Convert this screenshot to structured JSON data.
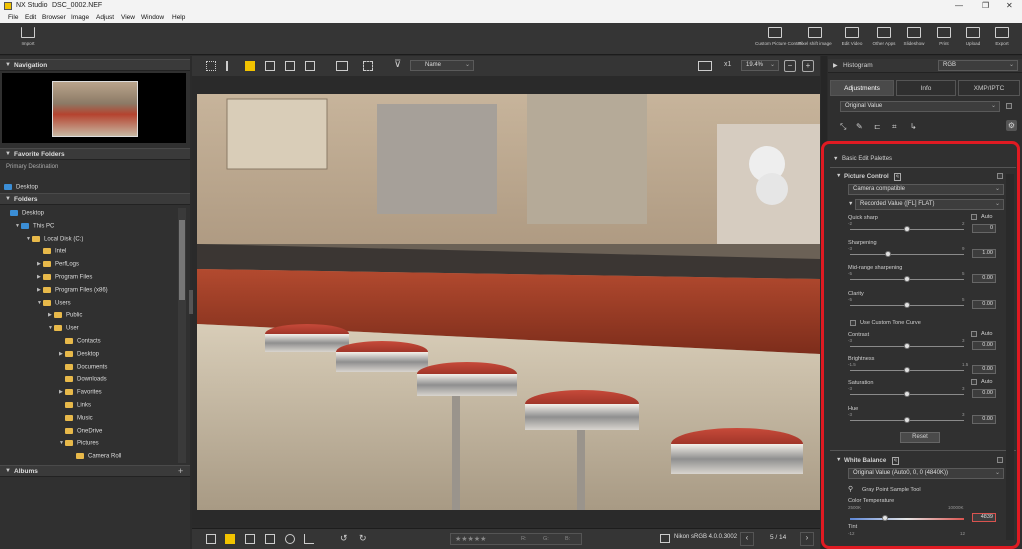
{
  "window": {
    "app_name": "NX Studio",
    "file_name": "DSC_0002.NEF"
  },
  "menu": [
    "File",
    "Edit",
    "Browser",
    "Image",
    "Adjust",
    "View",
    "Window",
    "Help"
  ],
  "toolbar": {
    "import_label": "Import",
    "buttons": [
      "Custom Picture Control",
      "Pixel shift image",
      "Edit Video",
      "Other Apps",
      "Slideshow",
      "Print",
      "Upload",
      "Export"
    ]
  },
  "left": {
    "navigation_title": "Navigation",
    "favorites_title": "Favorite Folders",
    "favorites_items": [
      "Primary Destination",
      "Desktop"
    ],
    "folders_title": "Folders",
    "albums_title": "Albums",
    "tree": [
      {
        "label": "Desktop",
        "indent": 0,
        "arrow": ""
      },
      {
        "label": "This PC",
        "indent": 1,
        "arrow": "▼"
      },
      {
        "label": "Local Disk (C:)",
        "indent": 2,
        "arrow": "▼"
      },
      {
        "label": "Intel",
        "indent": 3,
        "arrow": ""
      },
      {
        "label": "PerfLogs",
        "indent": 3,
        "arrow": "▶"
      },
      {
        "label": "Program Files",
        "indent": 3,
        "arrow": "▶"
      },
      {
        "label": "Program Files (x86)",
        "indent": 3,
        "arrow": "▶"
      },
      {
        "label": "Users",
        "indent": 3,
        "arrow": "▼"
      },
      {
        "label": "Public",
        "indent": 4,
        "arrow": "▶"
      },
      {
        "label": "User",
        "indent": 4,
        "arrow": "▼"
      },
      {
        "label": "Contacts",
        "indent": 5,
        "arrow": ""
      },
      {
        "label": "Desktop",
        "indent": 5,
        "arrow": "▶"
      },
      {
        "label": "Documents",
        "indent": 5,
        "arrow": ""
      },
      {
        "label": "Downloads",
        "indent": 5,
        "arrow": ""
      },
      {
        "label": "Favorites",
        "indent": 5,
        "arrow": "▶"
      },
      {
        "label": "Links",
        "indent": 5,
        "arrow": ""
      },
      {
        "label": "Music",
        "indent": 5,
        "arrow": ""
      },
      {
        "label": "OneDrive",
        "indent": 5,
        "arrow": ""
      },
      {
        "label": "Pictures",
        "indent": 5,
        "arrow": "▼"
      },
      {
        "label": "Camera Roll",
        "indent": 6,
        "arrow": ""
      }
    ]
  },
  "center": {
    "sort_label": "Name",
    "zoom_mult": "x1",
    "zoom_pct": "19.4%",
    "color_profile": "Nikon sRGB 4.0.0.3002",
    "page": "5 / 14",
    "rating_labels": [
      "R:",
      "G:",
      "B:"
    ]
  },
  "right": {
    "histogram_title": "Histogram",
    "histogram_channel": "RGB",
    "tabs": [
      "Adjustments",
      "Info",
      "XMP/IPTC"
    ],
    "preset": "Original Value",
    "basic_title": "Basic Edit Palettes",
    "picture_control": {
      "title": "Picture Control",
      "mode": "Camera compatible",
      "value": "Recorded Value ([FL] FLAT)",
      "auto_label": "Auto",
      "use_curve": "Use Custom Tone Curve",
      "reset_label": "Reset",
      "sliders": [
        {
          "label": "Quick sharp",
          "min": "-2",
          "max": "2",
          "value": "0",
          "pos": 0.5,
          "auto": true
        },
        {
          "label": "Sharpening",
          "min": "-3",
          "max": "9",
          "value": "1.00",
          "pos": 0.33,
          "auto": false
        },
        {
          "label": "Mid-range sharpening",
          "min": "-5",
          "max": "5",
          "value": "0.00",
          "pos": 0.5,
          "auto": false
        },
        {
          "label": "Clarity",
          "min": "-5",
          "max": "5",
          "value": "0.00",
          "pos": 0.5,
          "auto": false
        },
        {
          "label": "Contrast",
          "min": "-3",
          "max": "3",
          "value": "0.00",
          "pos": 0.5,
          "auto": true
        },
        {
          "label": "Brightness",
          "min": "-1.5",
          "max": "1.5",
          "value": "0.00",
          "pos": 0.5,
          "auto": false
        },
        {
          "label": "Saturation",
          "min": "-3",
          "max": "3",
          "value": "0.00",
          "pos": 0.5,
          "auto": true
        },
        {
          "label": "Hue",
          "min": "-3",
          "max": "3",
          "value": "0.00",
          "pos": 0.5,
          "auto": false
        }
      ]
    },
    "white_balance": {
      "title": "White Balance",
      "value": "Original Value (Auto0, 0, 0 (4840K))",
      "gray_point": "Gray Point Sample Tool",
      "temp_label": "Color Temperature",
      "temp_min": "2500K",
      "temp_max": "10000K",
      "temp_value": "4839",
      "temp_pos": 0.31,
      "tint_label": "Tint",
      "tint_min": "-12",
      "tint_max": "12"
    }
  }
}
